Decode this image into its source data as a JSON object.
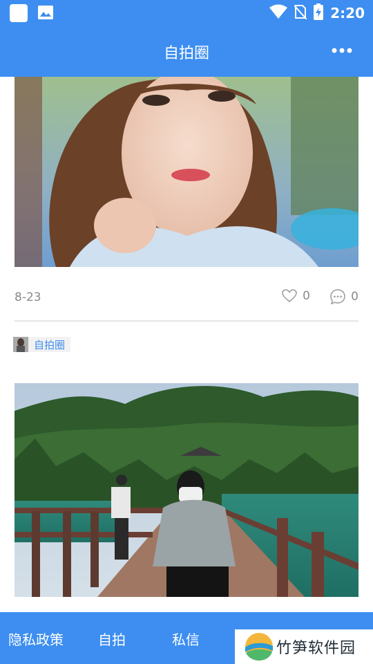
{
  "status_bar": {
    "time": "2:20",
    "icons": [
      "app-square-icon",
      "image-icon",
      "wifi-icon",
      "no-sim-icon",
      "battery-charging-icon"
    ]
  },
  "app_bar": {
    "title": "自拍圈",
    "more_icon": "more-horizontal-icon"
  },
  "feed": {
    "post1": {
      "date": "8-23",
      "likes": "0",
      "comments": "0"
    },
    "post2": {
      "tag": "自拍圈"
    }
  },
  "bottom_nav": {
    "items": [
      "隐私政策",
      "自拍",
      "私信"
    ]
  },
  "watermark": {
    "text": "竹笋软件园"
  },
  "colors": {
    "primary": "#3d8ef0",
    "muted_text": "#8a8a8a",
    "divider": "#e6e6e6"
  }
}
